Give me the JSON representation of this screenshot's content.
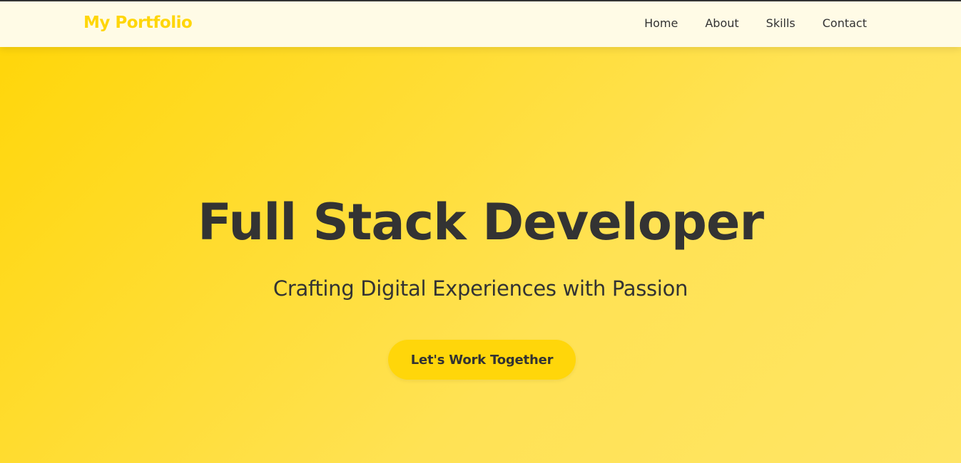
{
  "brand": {
    "name": "My Portfolio",
    "color": "#ffd60a"
  },
  "nav": {
    "items": [
      {
        "label": "Home"
      },
      {
        "label": "About"
      },
      {
        "label": "Skills"
      },
      {
        "label": "Contact"
      }
    ]
  },
  "hero": {
    "title": "Full Stack Developer",
    "subtitle": "Crafting Digital Experiences with Passion",
    "cta_label": "Let's Work Together"
  },
  "colors": {
    "accent": "#ffd60a",
    "text": "#333333",
    "navbar_bg": "#fffbe6",
    "hero_gradient_start": "#ffd60a",
    "hero_gradient_end": "#ffe566"
  }
}
